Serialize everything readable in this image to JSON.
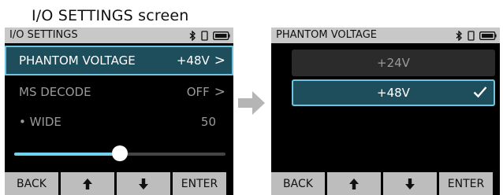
{
  "caption": "I/O SETTINGS screen",
  "icons": [
    "bluetooth-icon",
    "sd-card-icon",
    "battery-icon",
    "right-arrow-icon",
    "up-arrow-icon",
    "down-arrow-icon",
    "checkmark-icon"
  ],
  "colors": {
    "accent": "#6fc4df",
    "selected_bg": "#1e4e5c",
    "titlebar": "#c8c8c8",
    "button": "#bdbdbd"
  },
  "left_screen": {
    "title": "I/O SETTINGS",
    "items": [
      {
        "label": "PHANTOM VOLTAGE",
        "value": "+48V",
        "chevron": ">"
      },
      {
        "label": "MS DECODE",
        "value": "OFF",
        "chevron": ">"
      },
      {
        "label": "• WIDE",
        "value": "50"
      }
    ],
    "slider": {
      "value": 50,
      "max": 100
    },
    "buttons": [
      "BACK",
      "ENTER"
    ]
  },
  "right_screen": {
    "title": "PHANTOM VOLTAGE",
    "options": [
      "+24V",
      "+48V"
    ],
    "selected": "+48V",
    "buttons": [
      "BACK",
      "ENTER"
    ]
  }
}
